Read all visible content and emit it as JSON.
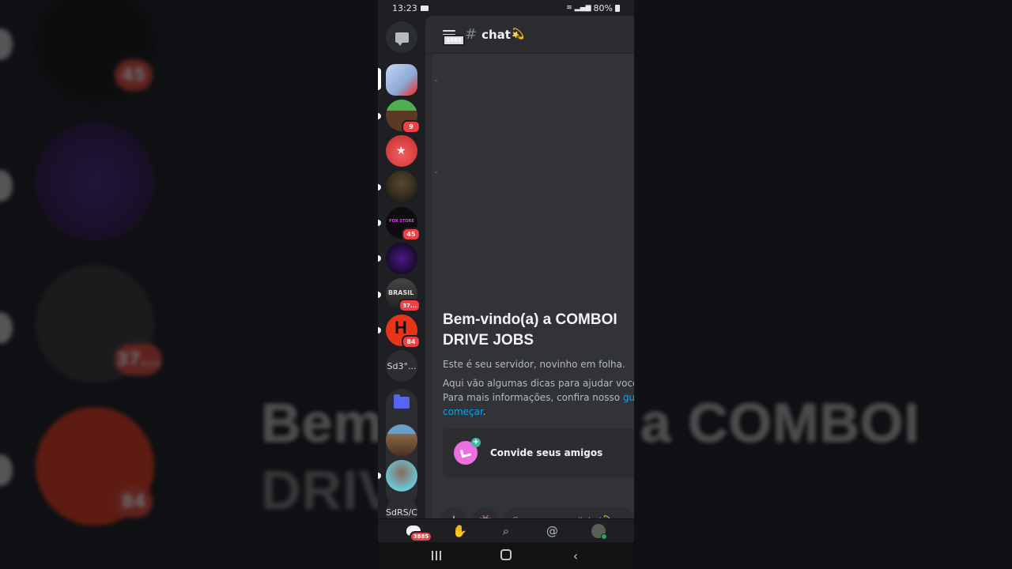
{
  "statusbar": {
    "time": "13:23",
    "battery": "80%"
  },
  "servers": [
    {
      "name": "server-1",
      "badge": null,
      "selected": true,
      "colors": [
        "#b8c6e8",
        "#7aa0d8"
      ]
    },
    {
      "name": "craftsopens",
      "badge": "9",
      "colors": [
        "#4caf50",
        "#5a3a22"
      ]
    },
    {
      "name": "red-crescent-star",
      "badge": null,
      "colors": [
        "#e53935",
        "#b71c1c"
      ]
    },
    {
      "name": "soldier",
      "badge": null,
      "colors": [
        "#3a3a2a",
        "#1a1a14"
      ]
    },
    {
      "name": "fox-store",
      "badge": "45",
      "label": "FOX STORE",
      "colors": [
        "#111",
        "#222"
      ]
    },
    {
      "name": "garcia",
      "badge": null,
      "colors": [
        "#6a1fa0",
        "#1a0a2a"
      ]
    },
    {
      "name": "brasil",
      "badge": "37...",
      "label": "BRASIL",
      "colors": [
        "#555",
        "#222"
      ]
    },
    {
      "name": "h-server",
      "badge": "84",
      "label": "H",
      "colors": [
        "#e53316",
        "#c42a10"
      ]
    },
    {
      "name": "sd3",
      "label": "Sd3°..."
    },
    {
      "name": "sdrs",
      "label": "SdRS/C"
    }
  ],
  "folder_members": [
    {
      "name": "folder-avatar-1",
      "colors": [
        "#6aa0c8",
        "#6a4a30"
      ]
    },
    {
      "name": "folder-avatar-2",
      "colors": [
        "#7fc8d8",
        "#5a4a40"
      ]
    }
  ],
  "channel": {
    "hamburger_badge": "3885",
    "hash": "#",
    "name": "chat",
    "emoji": "💫",
    "welcome_title": "Bem-vindo(a) a COMBOIO DRIVE JOBS",
    "welcome_line1": "Bem-vindo(a) a COMBOI",
    "welcome_line2": "DRIVE JOBS",
    "subtitle": "Este é seu servidor, novinho em folha.",
    "tips_line1": "Aqui vão algumas dicas para ajudar você a",
    "tips_line2_prefix": "Para mais informações, confira nosso ",
    "tips_link_a": "guia",
    "tips_link_b": "começar",
    "tips_end": ".",
    "invite_label": "Convide seus amigos",
    "composer_placeholder": "Conversar em #chat💫"
  },
  "bottomnav": {
    "home_badge": "3885"
  },
  "background": {
    "big_text_line1": "Bem-vindo(a) a COMBOI",
    "big_text_line2": "DRIVE JOBS",
    "badges": [
      "45",
      "37...",
      "84"
    ]
  }
}
